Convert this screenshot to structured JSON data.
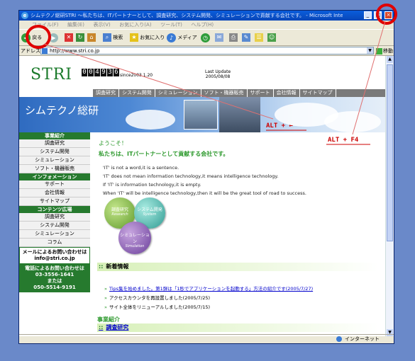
{
  "window": {
    "title": "シムテクノ総研STRI ～私たちは、ITパートナーとして、調査研究、システム開発、シミュレーションで貢献する会社です。 - Microsoft Internet Explorer",
    "buttons": [
      "_",
      "□",
      "×"
    ]
  },
  "menubar": [
    "ファイル(F)",
    "編集(E)",
    "表示(V)",
    "お気に入り(A)",
    "ツール(T)",
    "ヘルプ(H)"
  ],
  "toolbar": {
    "back": "戻る",
    "search": "検索",
    "favorites": "お気に入り",
    "media": "メディア"
  },
  "address": {
    "label": "アドレス(D)",
    "url": "http://www.stri.co.jp",
    "go": "移動"
  },
  "site": {
    "logo": "STRI",
    "counter": [
      "0",
      "0",
      "4",
      "9",
      "3",
      "6"
    ],
    "since": "since2003.1.20",
    "last_update_label": "Last Update",
    "last_update_date": "2005/08/08",
    "gnav": [
      "調査研究",
      "システム開発",
      "シミュレーション",
      "ソフト・機器販売",
      "サポート",
      "会社情報",
      "サイトマップ"
    ],
    "banner_title": "シムテクノ総研"
  },
  "sidenav": {
    "jigyo_head": "事業紹介",
    "jigyo": [
      "調査研究",
      "システム開発",
      "シミュレーション",
      "ソフト・機器販売"
    ],
    "info_head": "インフォメーション",
    "info": [
      "サポート",
      "会社情報",
      "サイトマップ"
    ],
    "contents_head": "コンテンツ広場",
    "contents": [
      "調査研究",
      "システム開発",
      "シミュレーション",
      "コラム"
    ],
    "mail_line1": "メールによるお問い合わせは",
    "mail_line2": "info@stri.co.jp",
    "tel_line1": "電話によるお問い合わせは",
    "tel_line2": "03-3556-1641",
    "tel_line3": "または",
    "tel_line4": "050-5514-9191"
  },
  "main": {
    "welcome": "ようこそ！",
    "tagline": "私たちは、ITパートナーとして貢献する会社です。",
    "it_lines": [
      "'IT' is not a word,it is a sentence.",
      "'IT' does not mean information technology,it means intelligence technology.",
      "If 'IT' is information technology,it is empty.",
      "When 'IT' will be intelligence technology,then it will be the great tool of road to success."
    ],
    "circles": {
      "research": "調査研究",
      "research_en": "Research",
      "system": "システム開発",
      "system_en": "System",
      "simulation": "シミュレーション",
      "simulation_en": "Simulation"
    },
    "news_head": "新着情報",
    "news": [
      "Tips集を始めました。第1弾は「1秒でアプリケーションを起動する」方法の紹介です(2005/7/27)",
      "アクセスカウンタを再設置しました(2005/7/25)",
      "サイト全体をリニューアルしました(2005/7/15)"
    ],
    "biz_label": "事業紹介",
    "biz_head": "調査研究"
  },
  "status": {
    "zone": "インターネット"
  },
  "annotations": {
    "alt_left": "ALT + ←",
    "alt_f4": "ALT + F4"
  }
}
